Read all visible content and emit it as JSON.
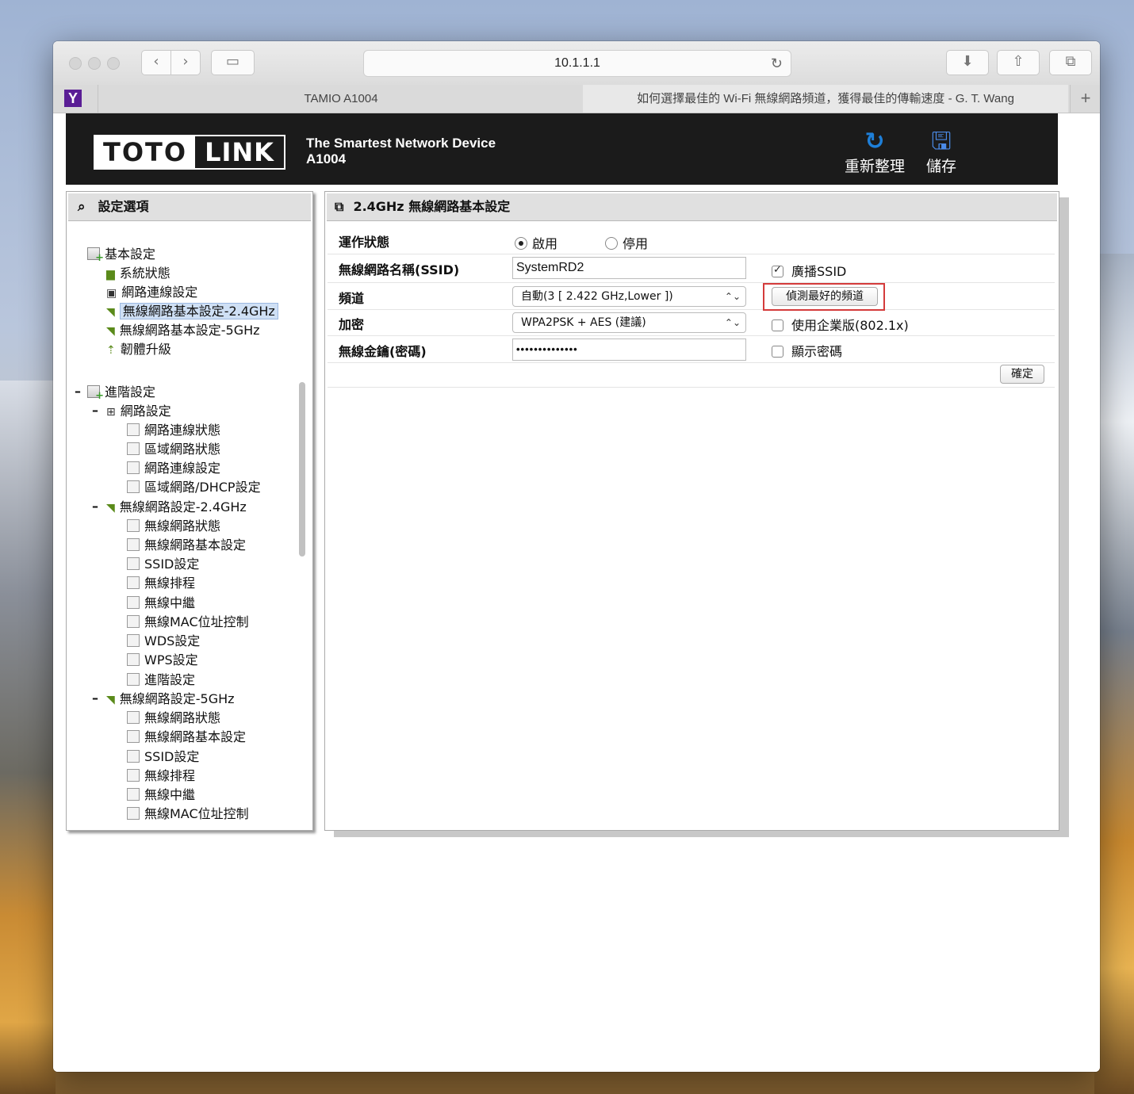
{
  "browser": {
    "url": "10.1.1.1",
    "tabs": [
      {
        "label": "TAMIO A1004"
      },
      {
        "label": "如何選擇最佳的 Wi-Fi 無線網路頻道，獲得最佳的傳輸速度 - G. T. Wang"
      }
    ],
    "favicon": "Y"
  },
  "banner": {
    "logo_left": "TOTO",
    "logo_right": "LINK",
    "tagline": "The Smartest Network Device",
    "model": "A1004",
    "refresh_label": "重新整理",
    "save_label": "儲存",
    "colors": {
      "background": "#1b1b1b",
      "refresh_icon": "#1e7fd8",
      "save_icon": "#2a6ad8"
    }
  },
  "sidebar": {
    "title": "設定選項",
    "basic": {
      "label": "基本設定",
      "items": [
        "系統狀態",
        "網路連線設定",
        "無線網路基本設定-2.4GHz",
        "無線網路基本設定-5GHz",
        "韌體升級"
      ],
      "selected": "無線網路基本設定-2.4GHz"
    },
    "advanced": {
      "label": "進階設定",
      "network": {
        "label": "網路設定",
        "items": [
          "網路連線狀態",
          "區域網路狀態",
          "網路連線設定",
          "區域網路/DHCP設定"
        ]
      },
      "wireless24": {
        "label": "無線網路設定-2.4GHz",
        "items": [
          "無線網路狀態",
          "無線網路基本設定",
          "SSID設定",
          "無線排程",
          "無線中繼",
          "無線MAC位址控制",
          "WDS設定",
          "WPS設定",
          "進階設定"
        ]
      },
      "wireless5": {
        "label": "無線網路設定-5GHz",
        "items": [
          "無線網路狀態",
          "無線網路基本設定",
          "SSID設定",
          "無線排程",
          "無線中繼",
          "無線MAC位址控制"
        ]
      }
    }
  },
  "main": {
    "title": "2.4GHz 無線網路基本設定",
    "rows": {
      "status": {
        "label": "運作狀態",
        "enable": "啟用",
        "disable": "停用",
        "selected": "啟用"
      },
      "ssid": {
        "label": "無線網路名稱(SSID)",
        "value": "SystemRD2",
        "broadcast_label": "廣播SSID",
        "broadcast_checked": true
      },
      "channel": {
        "label": "頻道",
        "value": "自動(3 [ 2.422 GHz,Lower ])",
        "detect_button": "偵測最好的頻道"
      },
      "encryption": {
        "label": "加密",
        "value": "WPA2PSK + AES (建議)",
        "enterprise_label": "使用企業版(802.1x)",
        "enterprise_checked": false
      },
      "key": {
        "label": "無線金鑰(密碼)",
        "value": "••••••••••••••",
        "show_label": "顯示密碼",
        "show_checked": false
      }
    },
    "ok_button": "確定",
    "highlight_color": "#d43b3b"
  }
}
